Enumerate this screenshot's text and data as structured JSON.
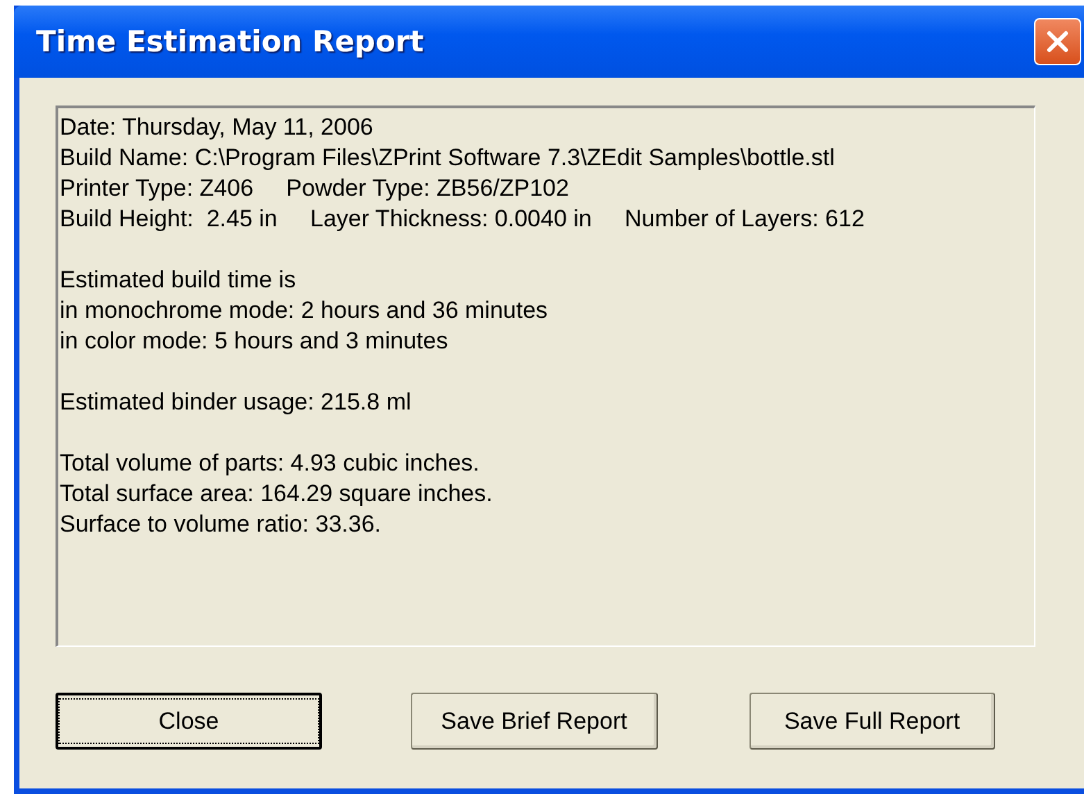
{
  "window": {
    "title": "Time Estimation Report"
  },
  "report": {
    "paragraphs": [
      [
        "Date: Thursday, May 11, 2006",
        "Build Name: C:\\Program Files\\ZPrint Software 7.3\\ZEdit Samples\\bottle.stl",
        "Printer Type: Z406     Powder Type: ZB56/ZP102",
        "Build Height:  2.45 in     Layer Thickness: 0.0040 in     Number of Layers: 612"
      ],
      [
        "Estimated build time is",
        "in monochrome mode: 2 hours and 36 minutes",
        "in color mode: 5 hours and 3 minutes"
      ],
      [
        "Estimated binder usage: 215.8 ml"
      ],
      [
        "Total volume of parts: 4.93 cubic inches.",
        "Total surface area: 164.29 square inches.",
        "Surface to volume ratio: 33.36."
      ]
    ]
  },
  "buttons": [
    {
      "label": "Close",
      "default": true
    },
    {
      "label": "Save Brief Report",
      "default": false
    },
    {
      "label": "Save Full Report",
      "default": false
    }
  ]
}
